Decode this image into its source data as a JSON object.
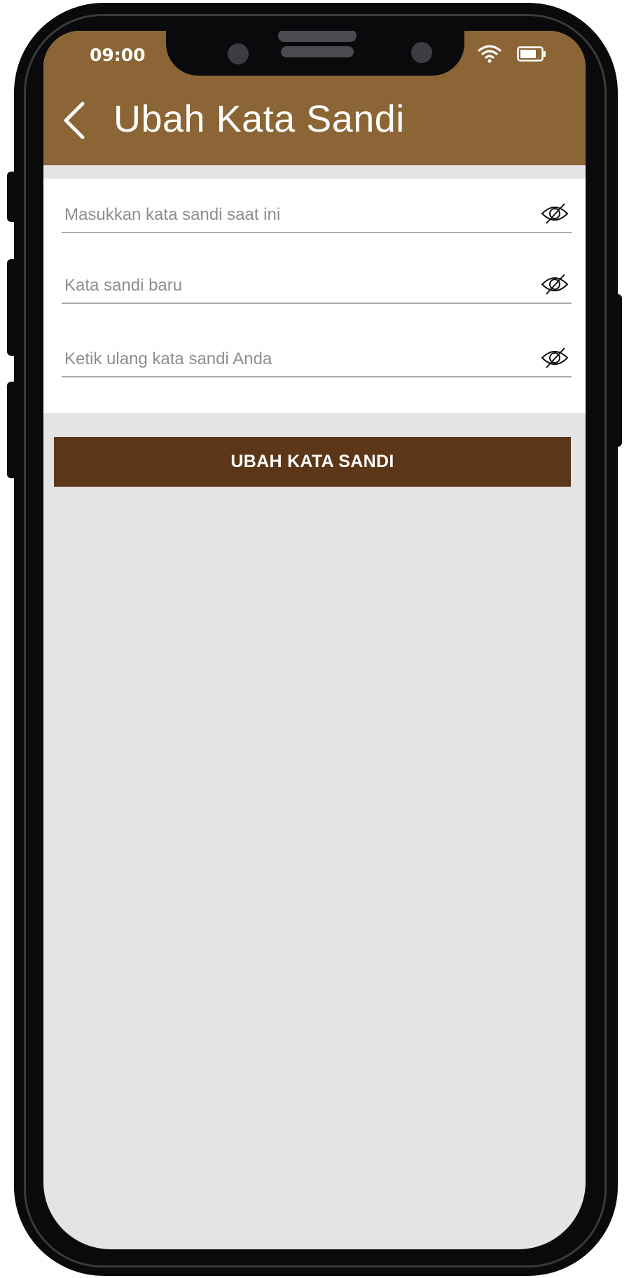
{
  "status_bar": {
    "time": "09:00",
    "icons": [
      "wifi-icon",
      "battery-icon"
    ]
  },
  "header": {
    "back_icon": "chevron-left-icon",
    "title": "Ubah Kata Sandi",
    "color": "#8b6535"
  },
  "form": {
    "fields": [
      {
        "placeholder": "Masukkan kata sandi saat ini",
        "value": "",
        "icon": "eye-off-icon"
      },
      {
        "placeholder": "Kata sandi baru",
        "value": "",
        "icon": "eye-off-icon"
      },
      {
        "placeholder": "Ketik ulang kata sandi Anda",
        "value": "",
        "icon": "eye-off-icon"
      }
    ]
  },
  "submit": {
    "label": "UBAH KATA SANDI",
    "color": "#5b3617"
  },
  "colors": {
    "background": "#e4e4e4",
    "text_on_header": "#ffffff"
  }
}
